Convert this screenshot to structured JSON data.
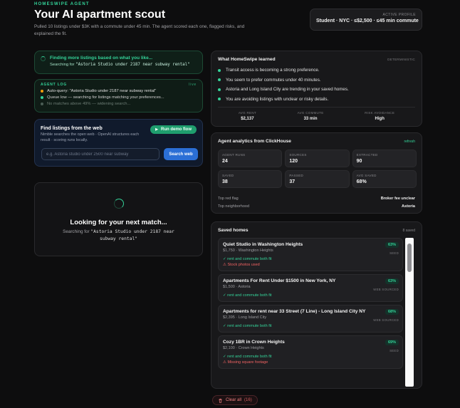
{
  "header": {
    "kicker": "HOMESWIPE AGENT",
    "title": "Your AI apartment scout",
    "subtitle": "Pulled 10 listings under $3K with a commute under 45 min. The agent scored each one, flagged risks, and explained the fit."
  },
  "profile": {
    "label": "ACTIVE PROFILE",
    "value": "Student · NYC · ≤$2,500 · ≤45 min commute"
  },
  "finding": {
    "title": "Finding more listings based on what you like...",
    "prefix": "Searching for ",
    "query": "\"Astoria Studio under 2187 near subway rental\""
  },
  "agent_log": {
    "title": "AGENT LOG",
    "status": "live",
    "lines": [
      {
        "text": "Auto-query: \"Astoria Studio under 2187 near subway rental\"",
        "color": "#f59e0b"
      },
      {
        "text": "Queue low — searching for listings matching your preferences...",
        "color": "#34d399"
      },
      {
        "text": "No matches above 49% — widening search...",
        "color": "#4b5d55"
      }
    ]
  },
  "web_search": {
    "title": "Find listings from the web",
    "description": "Nimble searches the open web · OpenAI structures each result · scoring runs locally.",
    "demo_button": "Run demo flow",
    "input_placeholder": "e.g. Astoria studio under 2500 near subway",
    "input_value": "",
    "search_button": "Search web"
  },
  "looking": {
    "title": "Looking for your next match...",
    "prefix": "Searching for ",
    "query": "\"Astoria Studio under 2187 near subway rental\""
  },
  "learned": {
    "title": "What HomeSwipe learned",
    "tag": "DETERMINISTIC",
    "insights": [
      "Transit access is becoming a strong preference.",
      "You seem to prefer commutes under 40 minutes.",
      "Astoria and Long Island City are trending in your saved homes.",
      "You are avoiding listings with unclear or risky details."
    ],
    "stats": [
      {
        "label": "AVG RENT",
        "value": "$2,137"
      },
      {
        "label": "AVG COMMUTE",
        "value": "33 min"
      },
      {
        "label": "RISK AVOIDANCE",
        "value": "High"
      }
    ]
  },
  "analytics": {
    "title": "Agent analytics from ClickHouse",
    "refresh": "refresh",
    "tiles": [
      {
        "label": "AGENT RUNS",
        "value": "24"
      },
      {
        "label": "SOURCES",
        "value": "120"
      },
      {
        "label": "EXTRACTED",
        "value": "90"
      },
      {
        "label": "SAVED",
        "value": "38"
      },
      {
        "label": "PASSED",
        "value": "37"
      },
      {
        "label": "AVG SAVED",
        "value": "68%"
      }
    ],
    "top_red_flag_label": "Top red flag",
    "top_red_flag": "Broker fee unclear",
    "top_neighborhood_label": "Top neighborhood",
    "top_neighborhood": "Astoria"
  },
  "saved": {
    "title": "Saved homes",
    "count": "8 saved",
    "homes": [
      {
        "name": "Quiet Studio in Washington Heights",
        "meta": "$1,750 · Washington Heights",
        "pct": "63%",
        "source": "SEED",
        "good": "✓ rent and commute both fit",
        "bad": "⚠ Stock photos used"
      },
      {
        "name": "Apartments For Rent Under $1500 in New York, NY",
        "meta": "$1,500 · Astoria",
        "pct": "63%",
        "source": "WEB SOURCED",
        "good": "✓ rent and commute both fit",
        "bad": ""
      },
      {
        "name": "Apartments for rent near 33 Street (7 Line) - Long Island City NY",
        "meta": "$2,395 · Long Island City",
        "pct": "68%",
        "source": "WEB SOURCED",
        "good": "✓ rent and commute both fit",
        "bad": ""
      },
      {
        "name": "Cozy 1BR in Crown Heights",
        "meta": "$2,100 · Crown Heights",
        "pct": "69%",
        "source": "SEED",
        "good": "✓ rent and commute both fit",
        "bad": "⚠ Missing square footage"
      }
    ]
  },
  "clear_all": {
    "label": "Clear all",
    "count": "(16)"
  },
  "colors": {
    "accent": "#34d399",
    "danger": "#f06262",
    "primary": "#2b6fd6"
  }
}
